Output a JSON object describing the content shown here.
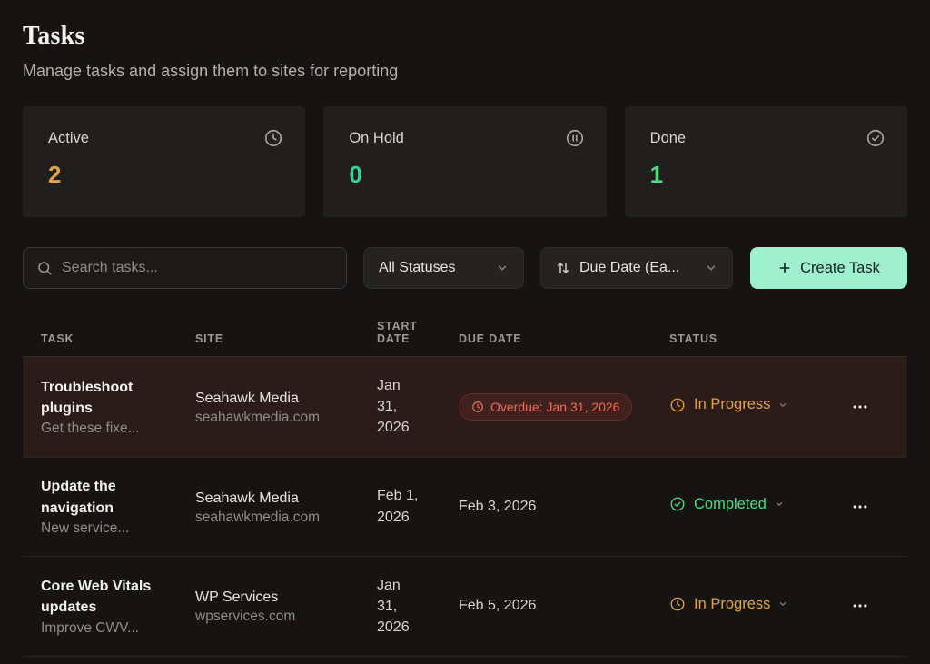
{
  "header": {
    "title": "Tasks",
    "subtitle": "Manage tasks and assign them to sites for reporting"
  },
  "stats": [
    {
      "label": "Active",
      "value": "2",
      "icon": "clock-icon",
      "value_color": "#e2a33e"
    },
    {
      "label": "On Hold",
      "value": "0",
      "icon": "pause-circle-icon",
      "value_color": "#35d399"
    },
    {
      "label": "Done",
      "value": "1",
      "icon": "check-circle-icon",
      "value_color": "#4ade80"
    }
  ],
  "toolbar": {
    "search_placeholder": "Search tasks...",
    "status_filter_value": "All Statuses",
    "sort_value": "Due Date (Ea...",
    "create_task_label": "Create Task",
    "create_task_color": "#9ef0cf"
  },
  "table": {
    "headers": [
      "TASK",
      "SITE",
      "START DATE",
      "DUE DATE",
      "STATUS"
    ],
    "rows": [
      {
        "task_title": "Troubleshoot plugins",
        "task_desc": "Get these fixe...",
        "site_name": "Seahawk Media",
        "site_domain": "seahawkmedia.com",
        "start_date": "Jan\n31,\n2026",
        "due_date": "Overdue: Jan 31, 2026",
        "overdue": true,
        "status": "In Progress",
        "status_color": "#e2a33e"
      },
      {
        "task_title": "Update the navigation",
        "task_desc": "New service...",
        "site_name": "Seahawk Media",
        "site_domain": "seahawkmedia.com",
        "start_date": "Feb 1,\n2026",
        "due_date": "Feb 3, 2026",
        "overdue": false,
        "status": "Completed",
        "status_color": "#4ade80"
      },
      {
        "task_title": "Core Web Vitals updates",
        "task_desc": "Improve CWV...",
        "site_name": "WP Services",
        "site_domain": "wpservices.com",
        "start_date": "Jan\n31,\n2026",
        "due_date": "Feb 5, 2026",
        "overdue": false,
        "status": "In Progress",
        "status_color": "#e2a33e"
      }
    ]
  }
}
